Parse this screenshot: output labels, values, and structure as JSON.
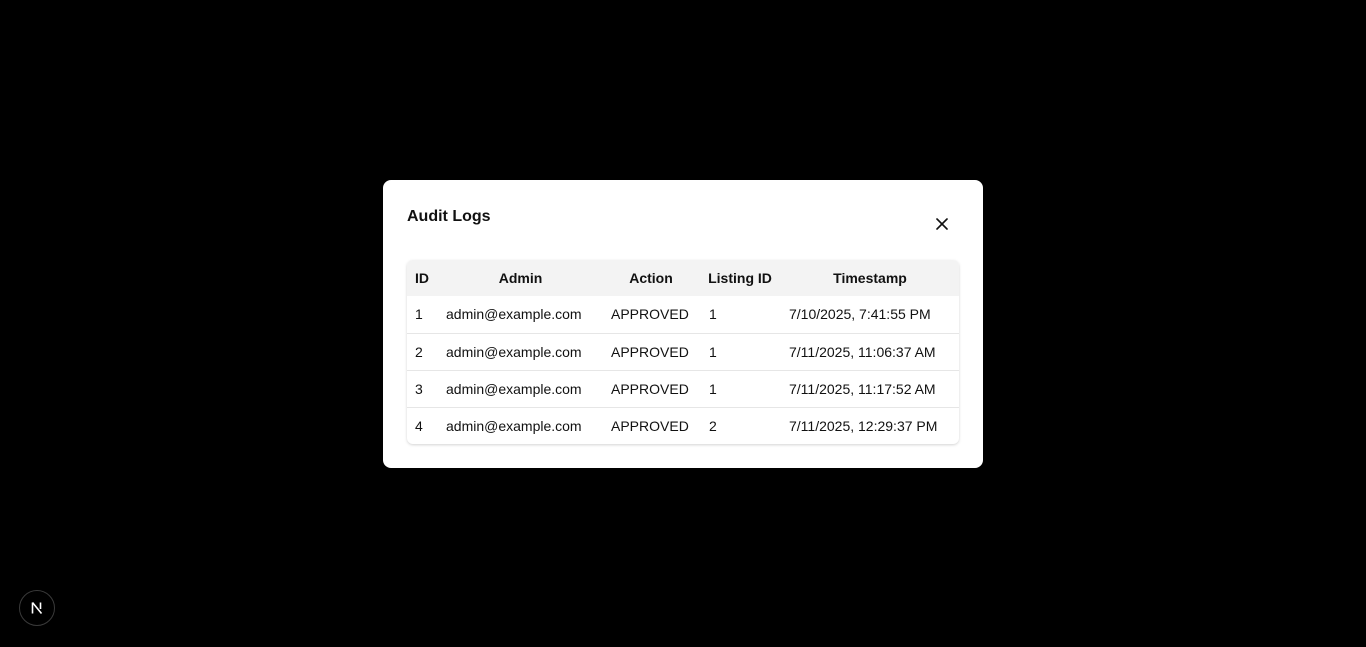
{
  "modal": {
    "title": "Audit Logs",
    "close_icon": "close-icon"
  },
  "table": {
    "columns": [
      "ID",
      "Admin",
      "Action",
      "Listing ID",
      "Timestamp"
    ],
    "rows": [
      {
        "id": "1",
        "admin": "admin@example.com",
        "action": "APPROVED",
        "listing_id": "1",
        "timestamp": "7/10/2025, 7:41:55 PM"
      },
      {
        "id": "2",
        "admin": "admin@example.com",
        "action": "APPROVED",
        "listing_id": "1",
        "timestamp": "7/11/2025, 11:06:37 AM"
      },
      {
        "id": "3",
        "admin": "admin@example.com",
        "action": "APPROVED",
        "listing_id": "1",
        "timestamp": "7/11/2025, 11:17:52 AM"
      },
      {
        "id": "4",
        "admin": "admin@example.com",
        "action": "APPROVED",
        "listing_id": "2",
        "timestamp": "7/11/2025, 12:29:37 PM"
      }
    ]
  },
  "dev_badge": {
    "icon": "nextjs-logo-icon"
  },
  "colors": {
    "backdrop": "#000000",
    "modal_bg": "#ffffff",
    "header_bg": "#f3f3f3",
    "text": "#111111",
    "row_border": "#e6e6e6"
  }
}
